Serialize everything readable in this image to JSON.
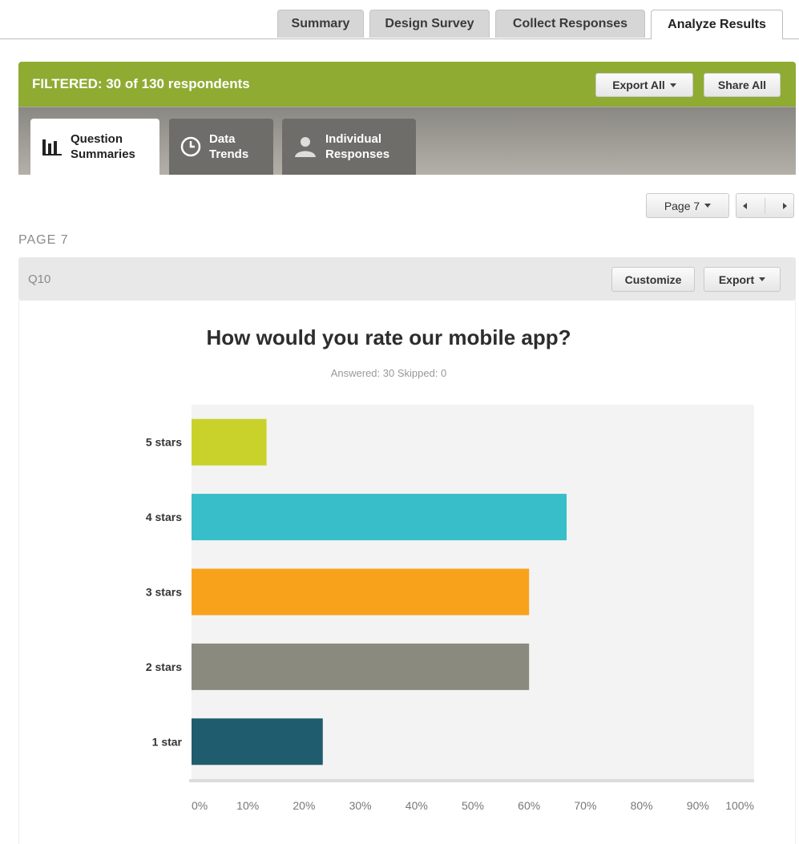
{
  "top_tabs": [
    {
      "label": "Summary",
      "active": false
    },
    {
      "label": "Design Survey",
      "active": false
    },
    {
      "label": "Collect Responses",
      "active": false
    },
    {
      "label": "Analyze Results",
      "active": true
    }
  ],
  "filter": {
    "text": "FILTERED: 30 of 130 respondents",
    "export_all": "Export All",
    "share_all": "Share All",
    "bar_color": "#8fab32"
  },
  "view_tabs": [
    {
      "label": "Question\nSummaries",
      "icon": "bar-chart-icon",
      "active": true
    },
    {
      "label": "Data\nTrends",
      "icon": "clock-icon",
      "active": false
    },
    {
      "label": "Individual\nResponses",
      "icon": "person-icon",
      "active": false
    }
  ],
  "pager": {
    "page_select": "Page 7"
  },
  "page_heading": "PAGE 7",
  "question": {
    "id": "Q10",
    "customize": "Customize",
    "export": "Export",
    "title": "How would you rate our mobile app?",
    "stats": "Answered: 30   Skipped: 0"
  },
  "chart_data": {
    "type": "bar",
    "orientation": "horizontal",
    "categories": [
      "5 stars",
      "4 stars",
      "3 stars",
      "2 stars",
      "1 star"
    ],
    "values": [
      13.33,
      66.67,
      60,
      60,
      23.33
    ],
    "colors": [
      "#c8d22a",
      "#38bec8",
      "#f8a21c",
      "#8a8a7e",
      "#1f5c6e"
    ],
    "x_ticks": [
      "0%",
      "10%",
      "20%",
      "30%",
      "40%",
      "50%",
      "60%",
      "70%",
      "80%",
      "90%",
      "100%"
    ],
    "xlim": [
      0,
      100
    ],
    "grid": false
  }
}
